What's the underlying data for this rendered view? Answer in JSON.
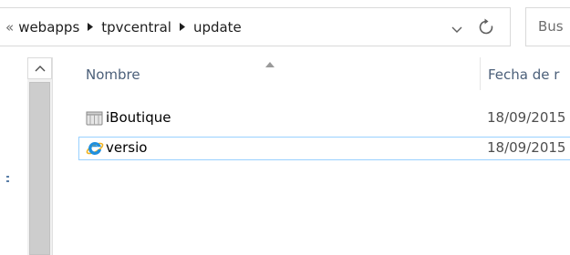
{
  "address_bar": {
    "overflow": "«",
    "breadcrumbs": [
      "webapps",
      "tpvcentral",
      "update"
    ]
  },
  "search": {
    "placeholder": "Bus"
  },
  "columns": {
    "name": "Nombre",
    "date": "Fecha de r"
  },
  "files": [
    {
      "name": "iBoutique",
      "date": "18/09/2015",
      "icon": "folder-icon"
    },
    {
      "name": "versio",
      "date": "18/09/2015",
      "icon": "internet-explorer-icon"
    }
  ],
  "colors": {
    "selection_border": "#99d1ff",
    "header_text": "#4c607a",
    "ie_blue": "#1f8fde"
  }
}
